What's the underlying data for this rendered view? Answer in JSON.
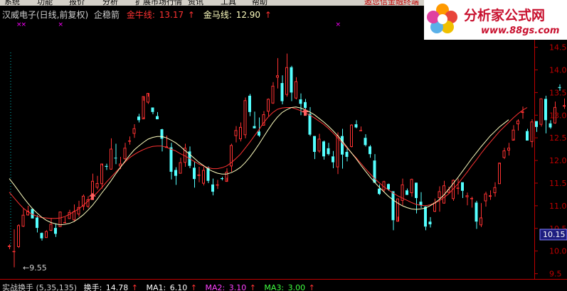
{
  "menu": {
    "items": [
      "系统",
      "功能",
      "报价",
      "分析",
      "扩展市场行情",
      "资讯",
      "工具",
      "帮助"
    ],
    "promo": "邀您信金融终端"
  },
  "header": {
    "title": "汉威电子(日线,前复权)",
    "formula": "企稳箭",
    "jnx_label": "金牛线:",
    "jnx_value": "13.17",
    "jmx_label": "金马线:",
    "jmx_value": "12.90",
    "arrow": "↑"
  },
  "logo": {
    "name": "分析家公式网",
    "url": "www.88gs.com"
  },
  "price_axis": {
    "ticks": [
      "14.5",
      "14.0",
      "13.5",
      "13.0",
      "12.5",
      "12.0",
      "11.5",
      "11.0",
      "10.5",
      "10.0",
      "9.5"
    ],
    "current": "10.15"
  },
  "low_marker": "←9.55",
  "indicator": {
    "name": "实战换手",
    "params": "(5,35,135)",
    "hs_label": "换手:",
    "hs_value": "14.78",
    "ma1_label": "MA1:",
    "ma1_value": "6.10",
    "ma2_label": "MA2:",
    "ma2_value": "3.10",
    "ma3_label": "MA3:",
    "ma3_value": "3.00",
    "arrow": "↑"
  },
  "colors": {
    "up": "#ff3232",
    "down": "#54ffff",
    "jnx_line": "#ff3232",
    "jmx_line": "#ffffc0",
    "signal_arrow": "#ff6060",
    "axis": "#c00000",
    "marker": "#ff00ff"
  },
  "chart_data": {
    "type": "candlestick",
    "ylim": [
      9.3,
      14.75
    ],
    "bars": [
      [
        10.09,
        10.12,
        10.04,
        10.15
      ],
      [
        9.99,
        10.0,
        9.64,
        10.48
      ],
      [
        10.09,
        10.57,
        10.07,
        10.59
      ],
      [
        10.54,
        10.8,
        10.53,
        10.95
      ],
      [
        10.79,
        10.89,
        10.78,
        11.0
      ],
      [
        10.93,
        10.72,
        10.74,
        10.91
      ],
      [
        10.74,
        10.51,
        10.41,
        10.79
      ],
      [
        10.4,
        10.28,
        10.23,
        10.41
      ],
      [
        10.29,
        10.44,
        10.29,
        10.46
      ],
      [
        10.45,
        10.6,
        10.44,
        10.73
      ],
      [
        10.51,
        10.38,
        10.31,
        10.61
      ],
      [
        10.53,
        10.87,
        10.53,
        10.87
      ],
      [
        10.62,
        10.64,
        10.62,
        10.75
      ],
      [
        10.71,
        10.86,
        10.72,
        10.91
      ],
      [
        10.68,
        10.88,
        10.66,
        11.03
      ],
      [
        10.81,
        10.97,
        10.76,
        11.11
      ],
      [
        10.98,
        11.22,
        10.9,
        11.25
      ],
      [
        10.98,
        11.14,
        10.95,
        11.21
      ],
      [
        11.24,
        11.55,
        11.26,
        11.71
      ],
      [
        11.4,
        11.5,
        11.36,
        11.66
      ],
      [
        11.48,
        11.93,
        11.38,
        11.89
      ],
      [
        11.88,
        11.86,
        11.79,
        11.93
      ],
      [
        11.8,
        12.26,
        11.81,
        12.49
      ],
      [
        12.06,
        12.05,
        11.92,
        12.37
      ],
      [
        11.87,
        11.93,
        11.81,
        12.08
      ],
      [
        12.03,
        12.28,
        12.01,
        12.39
      ],
      [
        12.42,
        12.44,
        12.35,
        12.53
      ],
      [
        12.59,
        12.71,
        12.5,
        12.8
      ],
      [
        12.97,
        12.89,
        12.84,
        13.03
      ],
      [
        12.91,
        13.42,
        12.96,
        13.32
      ],
      [
        13.28,
        13.49,
        13.25,
        13.41
      ],
      [
        13.17,
        13.07,
        13.02,
        13.1
      ],
      [
        12.98,
        12.91,
        12.94,
        13.07
      ],
      [
        12.69,
        12.48,
        12.2,
        12.7
      ],
      [
        12.28,
        12.31,
        12.3,
        12.55
      ],
      [
        12.29,
        11.75,
        11.58,
        12.39
      ],
      [
        11.79,
        11.66,
        11.46,
        11.85
      ],
      [
        11.71,
        11.96,
        11.71,
        12.06
      ],
      [
        11.95,
        12.28,
        11.86,
        12.37
      ],
      [
        12.2,
        11.88,
        11.83,
        12.31
      ],
      [
        11.84,
        11.59,
        11.4,
        11.98
      ],
      [
        11.66,
        11.69,
        11.52,
        11.86
      ],
      [
        11.49,
        11.79,
        11.45,
        11.86
      ],
      [
        11.84,
        11.55,
        11.5,
        11.87
      ],
      [
        11.47,
        11.31,
        11.23,
        11.6
      ],
      [
        11.47,
        11.47,
        11.37,
        11.57
      ],
      [
        11.61,
        11.59,
        11.56,
        11.64
      ],
      [
        11.53,
        11.75,
        11.62,
        11.83
      ],
      [
        11.87,
        12.34,
        11.75,
        12.37
      ],
      [
        12.54,
        12.67,
        12.4,
        12.76
      ],
      [
        12.47,
        12.74,
        12.42,
        12.84
      ],
      [
        12.56,
        13.33,
        12.49,
        13.39
      ],
      [
        13.43,
        13.07,
        12.98,
        13.47
      ],
      [
        12.76,
        12.71,
        12.74,
        13.08
      ],
      [
        12.64,
        12.55,
        12.52,
        12.95
      ],
      [
        12.77,
        13.02,
        12.79,
        13.09
      ],
      [
        13.08,
        13.36,
        12.98,
        13.37
      ],
      [
        13.26,
        13.65,
        13.25,
        13.73
      ],
      [
        13.83,
        13.88,
        13.59,
        14.26
      ],
      [
        13.71,
        13.31,
        13.24,
        13.88
      ],
      [
        13.45,
        14.06,
        13.41,
        14.36
      ],
      [
        14.06,
        13.5,
        13.31,
        14.09
      ],
      [
        13.37,
        13.75,
        13.35,
        13.84
      ],
      [
        13.35,
        13.25,
        13.0,
        13.48
      ],
      [
        13.29,
        13.16,
        13.13,
        13.36
      ],
      [
        13.03,
        12.57,
        12.54,
        13.18
      ],
      [
        12.54,
        12.19,
        12.03,
        12.51
      ],
      [
        12.2,
        12.48,
        12.17,
        12.59
      ],
      [
        12.42,
        12.09,
        12.02,
        12.44
      ],
      [
        12.27,
        12.14,
        12.11,
        12.39
      ],
      [
        12.09,
        11.96,
        11.83,
        12.21
      ],
      [
        11.85,
        12.55,
        11.7,
        12.62
      ],
      [
        12.54,
        12.13,
        11.82,
        12.7
      ],
      [
        12.19,
        12.08,
        11.98,
        12.27
      ],
      [
        12.3,
        12.79,
        12.29,
        12.8
      ],
      [
        12.8,
        12.73,
        12.71,
        12.89
      ],
      [
        12.65,
        12.67,
        12.65,
        12.75
      ],
      [
        12.5,
        12.34,
        12.31,
        12.58
      ],
      [
        12.31,
        12.14,
        12.06,
        12.34
      ],
      [
        12.0,
        11.51,
        11.5,
        12.14
      ],
      [
        11.38,
        11.26,
        11.24,
        11.47
      ],
      [
        11.34,
        11.54,
        11.31,
        11.55
      ],
      [
        11.48,
        11.36,
        11.33,
        11.49
      ],
      [
        11.32,
        10.68,
        10.46,
        11.27
      ],
      [
        10.65,
        11.16,
        10.76,
        11.15
      ],
      [
        11.11,
        11.47,
        11.01,
        11.6
      ],
      [
        11.34,
        11.24,
        11.28,
        11.38
      ],
      [
        11.28,
        11.59,
        11.2,
        11.6
      ],
      [
        11.51,
        11.17,
        10.83,
        11.47
      ],
      [
        11.09,
        11.01,
        10.95,
        11.3
      ],
      [
        10.98,
        10.54,
        10.46,
        10.99
      ],
      [
        10.65,
        10.59,
        10.52,
        10.75
      ],
      [
        10.87,
        11.07,
        10.86,
        11.16
      ],
      [
        11.17,
        11.32,
        10.87,
        11.43
      ],
      [
        11.05,
        11.45,
        11.06,
        11.55
      ],
      [
        11.29,
        11.36,
        11.27,
        11.42
      ],
      [
        11.15,
        11.57,
        11.11,
        11.58
      ],
      [
        11.39,
        11.4,
        11.25,
        11.6
      ],
      [
        11.52,
        11.33,
        11.17,
        11.52
      ],
      [
        11.19,
        11.23,
        11.01,
        11.29
      ],
      [
        11.16,
        11.17,
        10.96,
        11.2
      ],
      [
        11.07,
        10.65,
        10.49,
        11.11
      ],
      [
        10.57,
        10.74,
        10.53,
        11.06
      ],
      [
        11.1,
        11.27,
        10.98,
        11.31
      ],
      [
        11.2,
        11.23,
        11.13,
        11.34
      ],
      [
        11.28,
        11.41,
        11.2,
        11.52
      ],
      [
        11.48,
        11.95,
        11.48,
        11.92
      ],
      [
        12.06,
        12.22,
        12.03,
        12.28
      ],
      [
        12.22,
        12.28,
        12.11,
        12.39
      ],
      [
        12.44,
        12.68,
        12.48,
        12.78
      ],
      [
        12.8,
        12.88,
        12.66,
        12.91
      ],
      [
        13.05,
        13.08,
        12.92,
        13.19
      ],
      [
        12.65,
        12.44,
        12.45,
        12.7
      ],
      [
        12.41,
        12.86,
        12.29,
        12.91
      ],
      [
        12.87,
        12.74,
        12.63,
        12.79
      ],
      [
        12.79,
        13.37,
        12.75,
        13.36
      ],
      [
        13.36,
        12.89,
        12.6,
        13.43
      ],
      [
        12.82,
        12.73,
        12.7,
        12.89
      ],
      [
        12.82,
        13.18,
        12.81,
        13.3
      ],
      [
        13.62,
        13.6,
        13.54,
        13.68
      ],
      [
        13.19,
        13.22,
        13.14,
        13.37
      ],
      [
        13.3,
        12.87,
        12.84,
        13.34
      ],
      [
        13.03,
        13.5,
        12.99,
        13.65
      ],
      [
        13.64,
        14.6,
        13.27,
        14.73
      ]
    ],
    "jinniu_line": [
      11.3,
      11.18,
      11.06,
      10.95,
      10.87,
      10.81,
      10.77,
      10.74,
      10.73,
      10.72,
      10.72,
      10.73,
      10.76,
      10.81,
      10.87,
      10.93,
      11.01,
      11.1,
      11.19,
      11.29,
      11.4,
      11.52,
      11.63,
      11.74,
      11.85,
      11.96,
      12.06,
      12.13,
      12.19,
      12.24,
      12.28,
      12.31,
      12.32,
      12.32,
      12.29,
      12.25,
      12.21,
      12.15,
      12.1,
      12.04,
      11.98,
      11.92,
      11.88,
      11.84,
      11.82,
      11.82,
      11.84,
      11.88,
      11.95,
      12.04,
      12.14,
      12.27,
      12.4,
      12.54,
      12.68,
      12.83,
      12.96,
      13.06,
      13.13,
      13.16,
      13.17,
      13.17,
      13.14,
      13.1,
      13.05,
      13.0,
      12.94,
      12.87,
      12.8,
      12.71,
      12.61,
      12.5,
      12.39,
      12.28,
      12.17,
      12.06,
      11.94,
      11.82,
      11.71,
      11.6,
      11.51,
      11.42,
      11.35,
      11.28,
      11.22,
      11.17,
      11.12,
      11.07,
      11.03,
      11.01,
      11.0,
      11.02,
      11.06,
      11.11,
      11.18,
      11.26,
      11.37,
      11.48,
      11.61,
      11.74,
      11.88,
      12.01,
      12.15,
      12.28,
      12.4,
      12.52,
      12.64,
      12.74,
      12.84,
      12.94,
      13.03,
      13.11,
      13.17
    ],
    "jinma_line": [
      11.6,
      11.47,
      11.33,
      11.19,
      11.06,
      10.94,
      10.84,
      10.75,
      10.68,
      10.63,
      10.6,
      10.58,
      10.59,
      10.61,
      10.65,
      10.72,
      10.8,
      10.9,
      11.01,
      11.14,
      11.28,
      11.41,
      11.55,
      11.7,
      11.84,
      11.98,
      12.11,
      12.23,
      12.32,
      12.4,
      12.47,
      12.51,
      12.53,
      12.53,
      12.5,
      12.45,
      12.39,
      12.31,
      12.22,
      12.14,
      12.05,
      11.96,
      11.89,
      11.81,
      11.76,
      11.72,
      11.7,
      11.7,
      11.73,
      11.78,
      11.85,
      11.95,
      12.07,
      12.21,
      12.36,
      12.52,
      12.68,
      12.83,
      12.96,
      13.06,
      13.12,
      13.17,
      13.18,
      13.16,
      13.12,
      13.07,
      13.01,
      12.93,
      12.85,
      12.76,
      12.66,
      12.55,
      12.43,
      12.3,
      12.17,
      12.04,
      11.9,
      11.77,
      11.64,
      11.52,
      11.41,
      11.31,
      11.21,
      11.13,
      11.06,
      11.0,
      10.96,
      10.93,
      10.92,
      10.93,
      10.95,
      11.0,
      11.06,
      11.14,
      11.24,
      11.36,
      11.49,
      11.62,
      11.76,
      11.9,
      12.04,
      12.17,
      12.3,
      12.42,
      12.54,
      12.64,
      12.74,
      12.82,
      12.9
    ],
    "signals": [
      18,
      64,
      125
    ],
    "top_markers": [
      2,
      3,
      11,
      71,
      98,
      110,
      121
    ]
  }
}
